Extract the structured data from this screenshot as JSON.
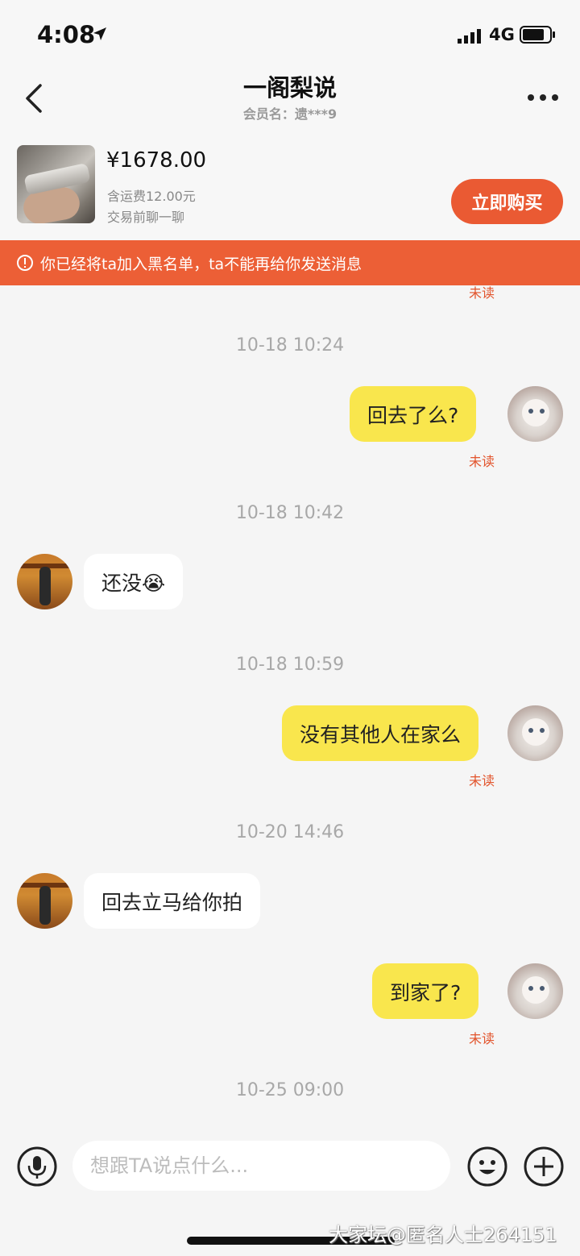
{
  "status": {
    "time": "4:08",
    "network": "4G"
  },
  "header": {
    "title": "一阁梨说",
    "subtitle": "会员名：遗***9"
  },
  "product": {
    "price": "¥1678.00",
    "shipping": "含运费12.00元",
    "hint": "交易前聊一聊",
    "buy_label": "立即购买"
  },
  "banner": {
    "text": "你已经将ta加入黑名单，ta不能再给你发送消息"
  },
  "messages": [
    {
      "type": "unread",
      "text": "未读"
    },
    {
      "type": "timestamp",
      "text": "10-18 10:24"
    },
    {
      "type": "me",
      "text": "回去了么?",
      "status": "未读"
    },
    {
      "type": "timestamp",
      "text": "10-18 10:42"
    },
    {
      "type": "other",
      "text": "还没😭"
    },
    {
      "type": "timestamp",
      "text": "10-18 10:59"
    },
    {
      "type": "me",
      "text": "没有其他人在家么",
      "status": "未读"
    },
    {
      "type": "timestamp",
      "text": "10-20 14:46"
    },
    {
      "type": "other",
      "text": "回去立马给你拍"
    },
    {
      "type": "me",
      "text": "到家了?",
      "status": "未读"
    },
    {
      "type": "timestamp",
      "text": "10-25 09:00"
    }
  ],
  "input": {
    "placeholder": "想跟TA说点什么..."
  },
  "icons": {
    "back": "chevron-left-icon",
    "more": "more-dots-icon",
    "mic": "microphone-icon",
    "emoji": "emoji-icon",
    "plus": "plus-icon",
    "warning": "warning-circle-icon"
  },
  "colors": {
    "accent": "#ea5a33",
    "my_bubble": "#f9e64d",
    "unread": "#e2542c"
  },
  "watermark": "大家坛@匿名人士264151"
}
